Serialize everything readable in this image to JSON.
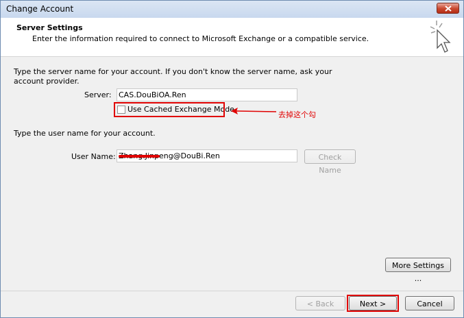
{
  "window": {
    "title": "Change Account"
  },
  "header": {
    "title": "Server Settings",
    "subtitle": "Enter the information required to connect to Microsoft Exchange or a compatible service."
  },
  "server_section": {
    "instruction_line1": "Type the server name for your account. If you don't know the server name, ask your",
    "instruction_line2": "account provider.",
    "server_label": "Server:",
    "server_value": "CAS.DouBiOA.Ren",
    "cached_mode_label": "Use Cached Exchange Mode",
    "cached_mode_checked": false
  },
  "user_section": {
    "instruction": "Type the user name for your account.",
    "username_label": "User Name:",
    "username_value": "Zhang.Jinpeng@DouBi.Ren",
    "check_name_label": "Check Name"
  },
  "annotation": {
    "text": "去掉这个勾",
    "color": "#e00000"
  },
  "buttons": {
    "more_settings": "More Settings ...",
    "back": "< Back",
    "next": "Next >",
    "cancel": "Cancel"
  },
  "icons": {
    "close": "close-icon",
    "wizard": "cursor-sparkle-icon",
    "arrow": "arrow-left-icon"
  }
}
